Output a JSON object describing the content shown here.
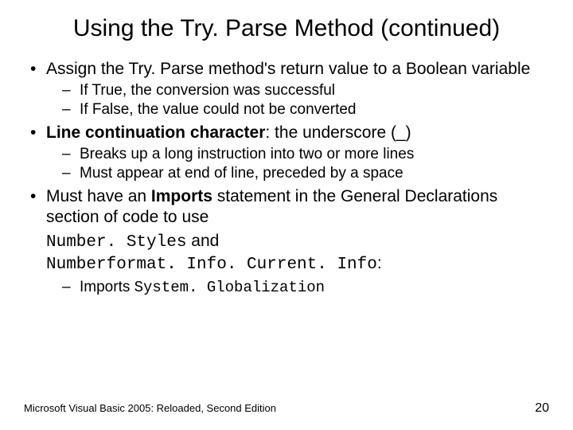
{
  "title": "Using the Try. Parse Method (continued)",
  "bullets": [
    {
      "text": "Assign the Try. Parse method's return value to a Boolean variable",
      "sub": [
        "If True, the conversion was successful",
        "If False, the value could not be converted"
      ]
    },
    {
      "prefix": "Line continuation character",
      "suffix": ": the underscore (_)",
      "sub": [
        "Breaks up a long instruction into two or more lines",
        "Must appear at end of line, preceded by a space"
      ]
    }
  ],
  "bullet3": {
    "a": "Must have an ",
    "b": "Imports",
    "c": " statement in the General Declarations section of code to use ",
    "code1": "Number. Styles",
    "mid": " and ",
    "code2": "Numberformat. Info. Current. Info",
    "end": ":",
    "sub_prefix": "Imports ",
    "sub_code": "System. Globalization"
  },
  "footer": {
    "left": "Microsoft Visual Basic 2005: Reloaded, Second Edition",
    "right": "20"
  }
}
